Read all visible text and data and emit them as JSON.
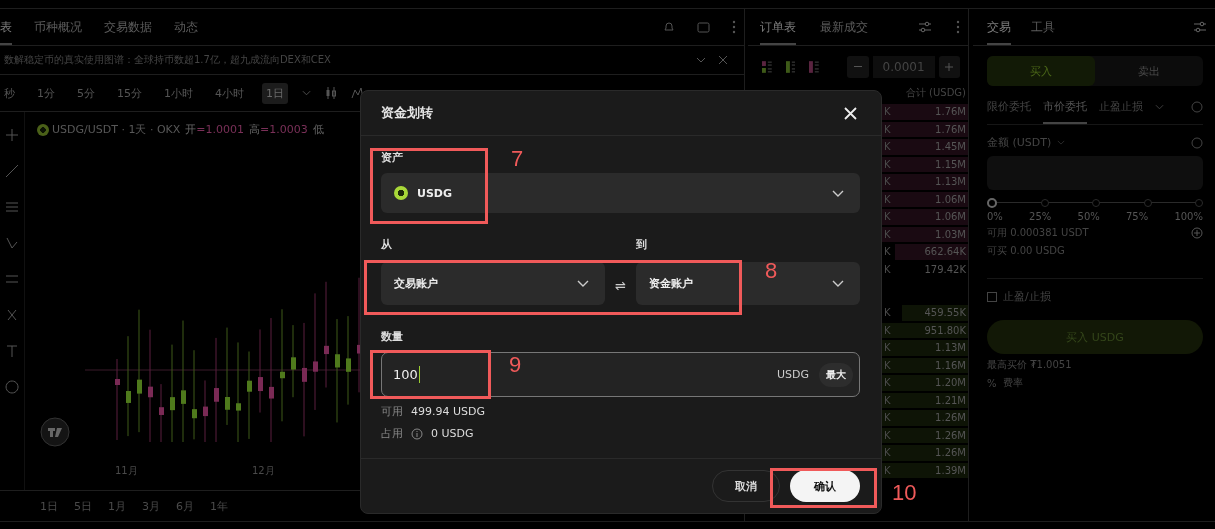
{
  "chart_panel": {
    "tabs": [
      {
        "label": "表",
        "selected": true
      },
      {
        "label": "币种概况",
        "selected": false
      },
      {
        "label": "交易数据",
        "selected": false
      },
      {
        "label": "动态",
        "selected": false
      }
    ],
    "announcement": "数解稳定币的真实使用图谱：全球持币数超1.7亿，超九成流向DEX和CEX",
    "intervals": [
      {
        "label": "秒",
        "selected": false
      },
      {
        "label": "1分",
        "selected": false
      },
      {
        "label": "5分",
        "selected": false
      },
      {
        "label": "15分",
        "selected": false
      },
      {
        "label": "1小时",
        "selected": false
      },
      {
        "label": "4小时",
        "selected": false
      },
      {
        "label": "1日",
        "selected": true
      }
    ],
    "symbol": {
      "pair": "USDG/USDT · 1天 · OKX",
      "stats": [
        {
          "label": "开",
          "value": "=1.0001"
        },
        {
          "label": "高",
          "value": "=1.0003"
        },
        {
          "label": "低"
        }
      ]
    },
    "month_labels": [
      "11月",
      "12月"
    ],
    "ranges": [
      "1日",
      "5日",
      "1月",
      "3月",
      "6月",
      "1年"
    ]
  },
  "order_book": {
    "tabs": [
      {
        "label": "订单表",
        "selected": true
      },
      {
        "label": "最新成交",
        "selected": false
      }
    ],
    "tick_size": "0.0001",
    "total_header": "合计 (USDG)",
    "asks": [
      {
        "size": "K",
        "total": "1.76M"
      },
      {
        "size": "K",
        "total": "1.76M"
      },
      {
        "size": "K",
        "total": "1.45M"
      },
      {
        "size": "K",
        "total": "1.15M"
      },
      {
        "size": "K",
        "total": "1.13M"
      },
      {
        "size": "K",
        "total": "1.06M"
      },
      {
        "size": "K",
        "total": "1.06M"
      },
      {
        "size": "K",
        "total": "1.03M"
      },
      {
        "size": "K",
        "total": "662.64K"
      },
      {
        "size": "K",
        "total": "179.42K"
      }
    ],
    "bids": [
      {
        "size": "K",
        "total": "459.55K"
      },
      {
        "size": "K",
        "total": "951.80K"
      },
      {
        "size": "K",
        "total": "1.13M"
      },
      {
        "size": "K",
        "total": "1.16M"
      },
      {
        "size": "K",
        "total": "1.20M"
      },
      {
        "size": "K",
        "total": "1.21M"
      },
      {
        "size": "K",
        "total": "1.26M"
      },
      {
        "size": "K",
        "total": "1.26M"
      },
      {
        "size": "K",
        "total": "1.26M"
      },
      {
        "size": "K",
        "total": "1.39M"
      }
    ]
  },
  "trade_panel": {
    "tabs": [
      {
        "label": "交易",
        "selected": true
      },
      {
        "label": "工具",
        "selected": false
      }
    ],
    "sides": [
      {
        "label": "买入",
        "selected": true
      },
      {
        "label": "卖出",
        "selected": false
      }
    ],
    "order_types": [
      {
        "label": "限价委托",
        "selected": false
      },
      {
        "label": "市价委托",
        "selected": true
      },
      {
        "label": "止盈止损",
        "selected": false
      }
    ],
    "amount_label": "金额 (USDT)",
    "slider": {
      "level": 0,
      "marks": [
        "0%",
        "25%",
        "50%",
        "75%",
        "100%"
      ]
    },
    "available": "可用 0.000381 USDT",
    "can_buy": "可买 0.00 USDG",
    "tp_sl": {
      "label": "止盈/止损",
      "checked": false
    },
    "submit": "买入 USDG",
    "max_price": "最高买价 ₮1.0051",
    "fee_icon": "%",
    "fee": "费率"
  },
  "dialog": {
    "title": "资金划转",
    "asset": {
      "label": "资产",
      "value": "USDG"
    },
    "from": {
      "label": "从",
      "value": "交易账户"
    },
    "to": {
      "label": "到",
      "value": "资金账户"
    },
    "swap_icon": "⇌",
    "quantity": {
      "label": "数量",
      "value": "100",
      "unit": "USDG",
      "max": "最大"
    },
    "available": {
      "label": "可用",
      "value": "499.94 USDG"
    },
    "occupied": {
      "label": "占用",
      "value": "0 USDG"
    },
    "buttons": [
      {
        "label": "取消",
        "kind": "secondary"
      },
      {
        "label": "确认",
        "kind": "primary"
      }
    ]
  },
  "annotations": [
    {
      "label": "7"
    },
    {
      "label": "8"
    },
    {
      "label": "9"
    },
    {
      "label": "10"
    }
  ]
}
